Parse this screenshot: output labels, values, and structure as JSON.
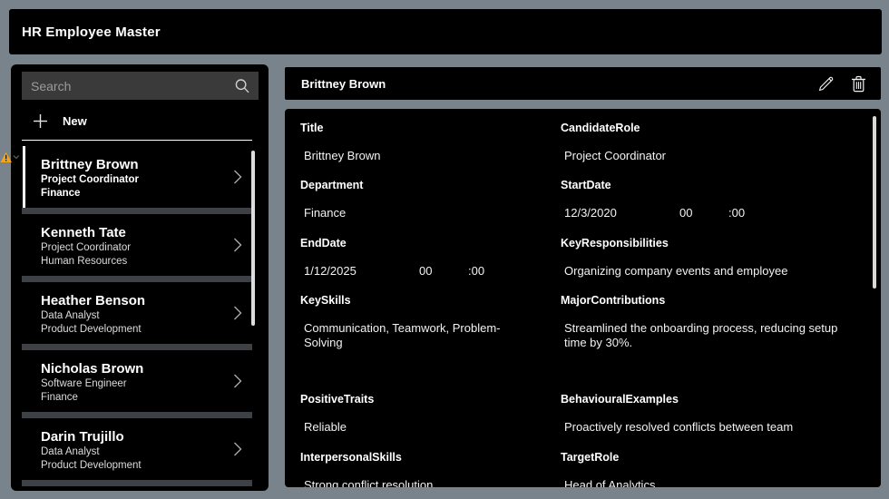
{
  "app": {
    "title": "HR Employee Master"
  },
  "colors": {
    "background": "#78838B",
    "panel": "#000000",
    "search_box": "#3A3A3A",
    "list_divider": "#3D4145",
    "text": "#FFFFFF",
    "warning": "#F2A51C"
  },
  "sidebar": {
    "search_placeholder": "Search",
    "new_label": "New",
    "items": [
      {
        "name": "Brittney Brown",
        "role": "Project Coordinator",
        "department": "Finance",
        "selected": true
      },
      {
        "name": "Kenneth Tate",
        "role": "Project Coordinator",
        "department": "Human Resources",
        "selected": false
      },
      {
        "name": "Heather Benson",
        "role": "Data Analyst",
        "department": "Product Development",
        "selected": false
      },
      {
        "name": "Nicholas Brown",
        "role": "Software Engineer",
        "department": "Finance",
        "selected": false
      },
      {
        "name": "Darin Trujillo",
        "role": "Data Analyst",
        "department": "Product Development",
        "selected": false
      }
    ]
  },
  "detail": {
    "title": "Brittney Brown",
    "rows": [
      [
        {
          "label": "Title",
          "value": "Brittney Brown"
        },
        {
          "label": "CandidateRole",
          "value": "Project Coordinator"
        }
      ],
      [
        {
          "label": "Department",
          "value": "Finance"
        },
        {
          "label": "StartDate",
          "date": "12/3/2020",
          "hour": "00",
          "minute": ":00"
        }
      ],
      [
        {
          "label": "EndDate",
          "date": "1/12/2025",
          "hour": "00",
          "minute": ":00"
        },
        {
          "label": "KeyResponsibilities",
          "value": "Organizing company events and employee",
          "truncate": true
        }
      ],
      [
        {
          "label": "KeySkills",
          "value": "Communication, Teamwork, Problem-Solving"
        },
        {
          "label": "MajorContributions",
          "value": "Streamlined the onboarding process, reducing setup time by 30%."
        }
      ],
      [
        {
          "label": "PositiveTraits",
          "value": "Reliable"
        },
        {
          "label": "BehaviouralExamples",
          "value": "Proactively resolved conflicts between team",
          "truncate": true
        }
      ],
      [
        {
          "label": "InterpersonalSkills",
          "value": "Strong conflict resolution"
        },
        {
          "label": "TargetRole",
          "value": "Head of Analytics"
        }
      ]
    ]
  }
}
